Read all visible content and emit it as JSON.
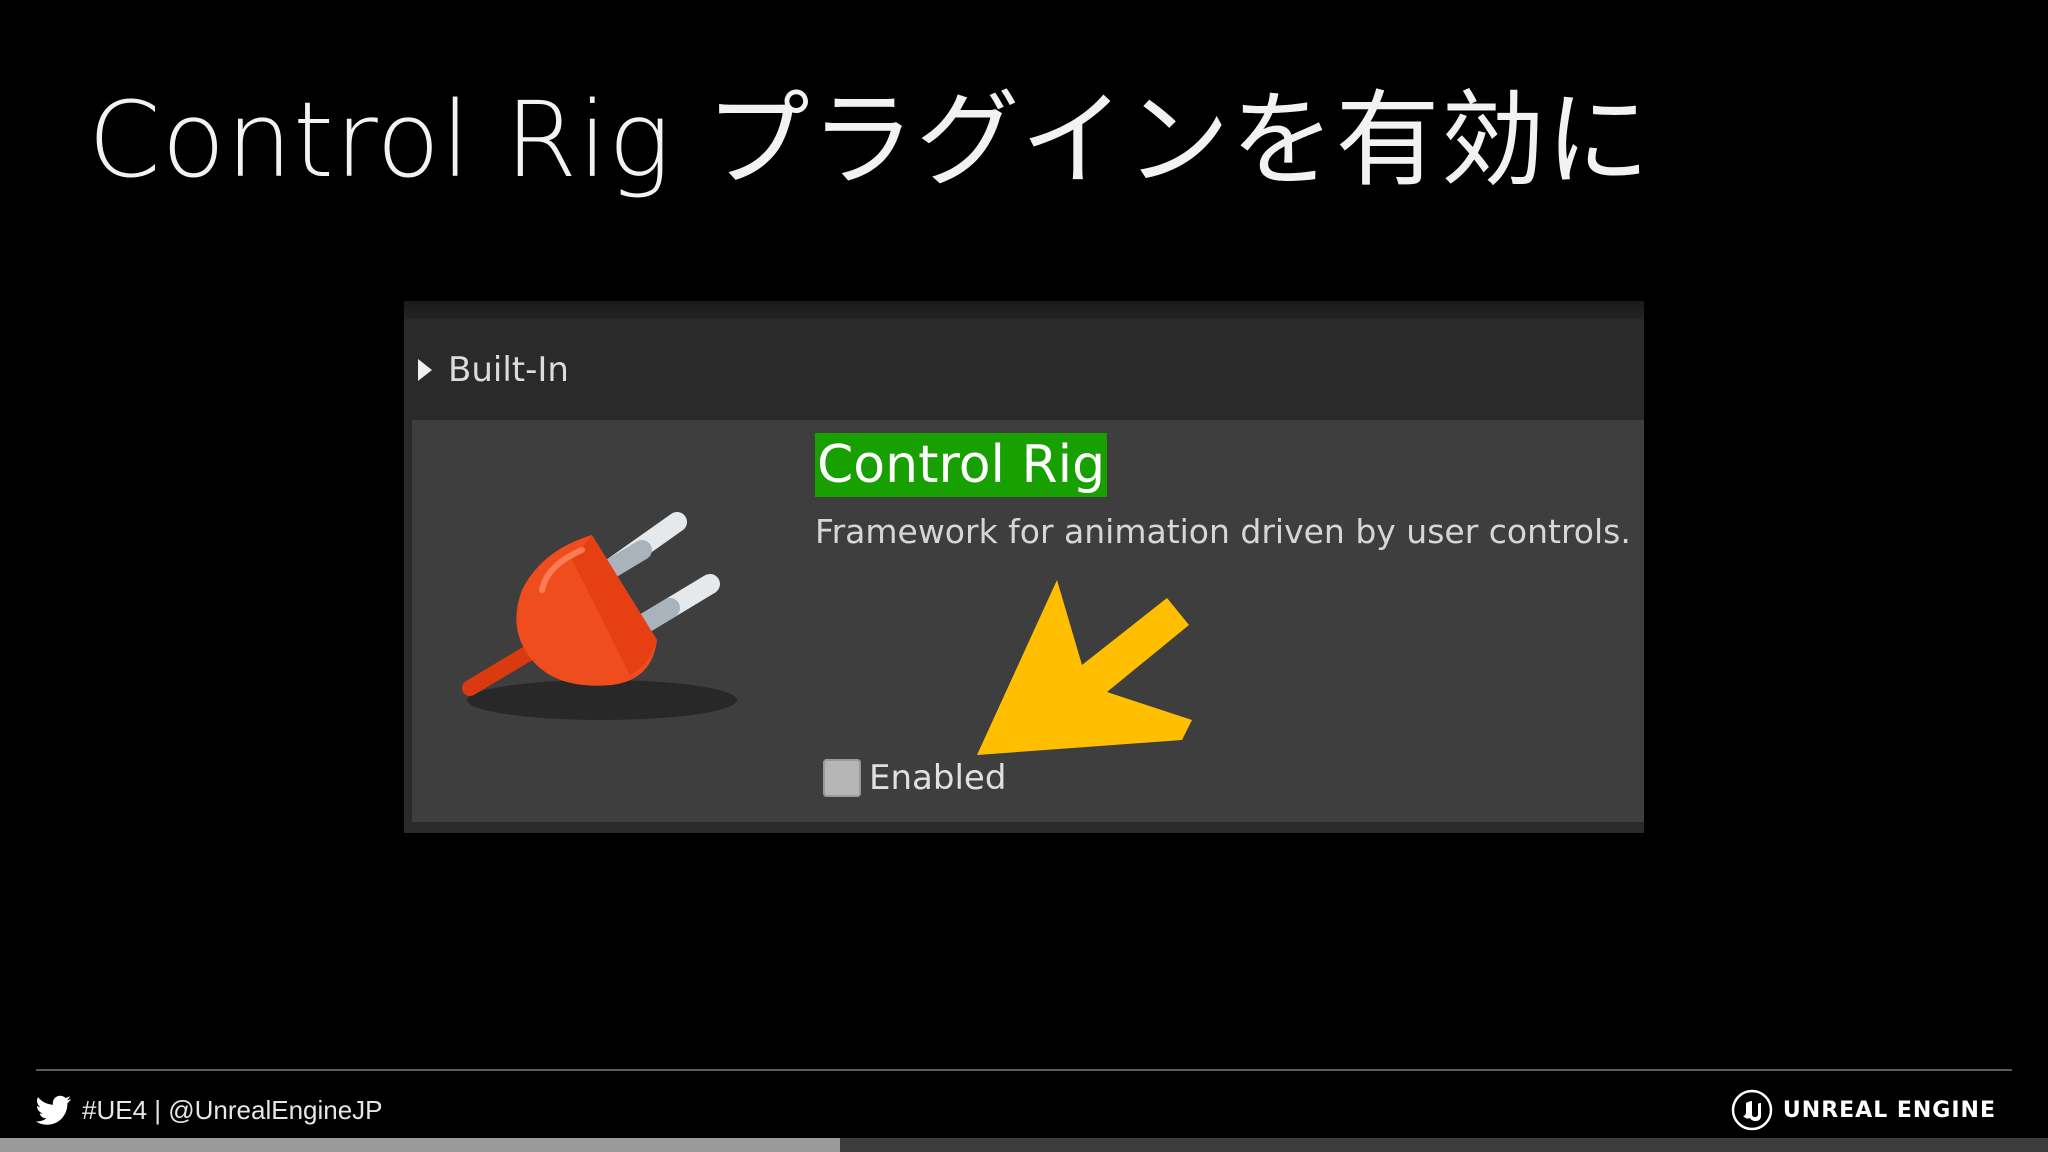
{
  "slide": {
    "title": "Control Rig プラグインを有効に"
  },
  "plugin_browser": {
    "category": {
      "label": "Built-In",
      "expanded": false
    },
    "plugin": {
      "name": "Control Rig",
      "name_highlight_color": "#17a000",
      "description": "Framework for animation driven by user controls.",
      "icon": "plug-icon",
      "enabled_label": "Enabled",
      "enabled": false
    },
    "annotation": {
      "icon": "arrow-icon",
      "color": "#ffbf00"
    }
  },
  "footer": {
    "social_icon": "twitter-icon",
    "social_text": "#UE4 | @UnrealEngineJP",
    "brand_logo": "unreal-engine-logo-icon",
    "brand_text": "UNREAL ENGINE"
  },
  "progress": {
    "fraction": 0.41
  }
}
